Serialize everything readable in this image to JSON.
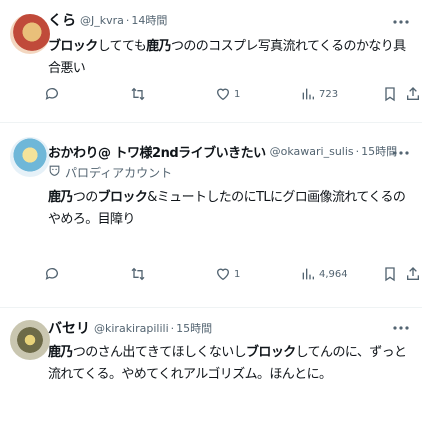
{
  "tweets": [
    {
      "name": "くら",
      "handle": "@J_kvra",
      "sep": "·",
      "time": "14時間",
      "parody_label": "",
      "text_segments": [
        {
          "t": "ブロック",
          "b": true
        },
        {
          "t": "してても",
          "b": false
        },
        {
          "t": "鹿乃",
          "b": true
        },
        {
          "t": "つののコスプレ写真流れてくるのかなり具合悪い",
          "b": false
        }
      ],
      "replies": "",
      "retweets": "",
      "likes": "1",
      "views": "723"
    },
    {
      "name": "おかわり@ トワ様2ndライブいきたい",
      "handle": "@okawari_sulis",
      "sep": "·",
      "time": "15時間",
      "parody_label": "パロディアカウント",
      "text_segments": [
        {
          "t": "鹿乃",
          "b": true
        },
        {
          "t": "つの",
          "b": false
        },
        {
          "t": "ブロック",
          "b": true
        },
        {
          "t": "&ミュートしたのにTLにグロ画像流れてくるのやめろ。目障り",
          "b": false
        }
      ],
      "replies": "",
      "retweets": "",
      "likes": "1",
      "views": "4,964"
    },
    {
      "name": "バセリ",
      "handle": "@kirakirapilili",
      "sep": "·",
      "time": "15時間",
      "parody_label": "",
      "text_segments": [
        {
          "t": "鹿乃",
          "b": true
        },
        {
          "t": "つのさん出てきてほしくないし",
          "b": false
        },
        {
          "t": "ブロック",
          "b": true
        },
        {
          "t": "してんのに、ずっと流れてくる。やめてくれアルゴリズム。ほんとに。",
          "b": false
        }
      ],
      "replies": "",
      "retweets": "",
      "likes": "",
      "views": ""
    }
  ],
  "colors": {
    "text": "#0f1419",
    "muted": "#536471",
    "divider": "#eff3f4"
  },
  "icons": [
    "reply-icon",
    "retweet-icon",
    "like-icon",
    "views-icon",
    "bookmark-icon",
    "share-icon",
    "more-icon",
    "parody-badge-icon"
  ]
}
